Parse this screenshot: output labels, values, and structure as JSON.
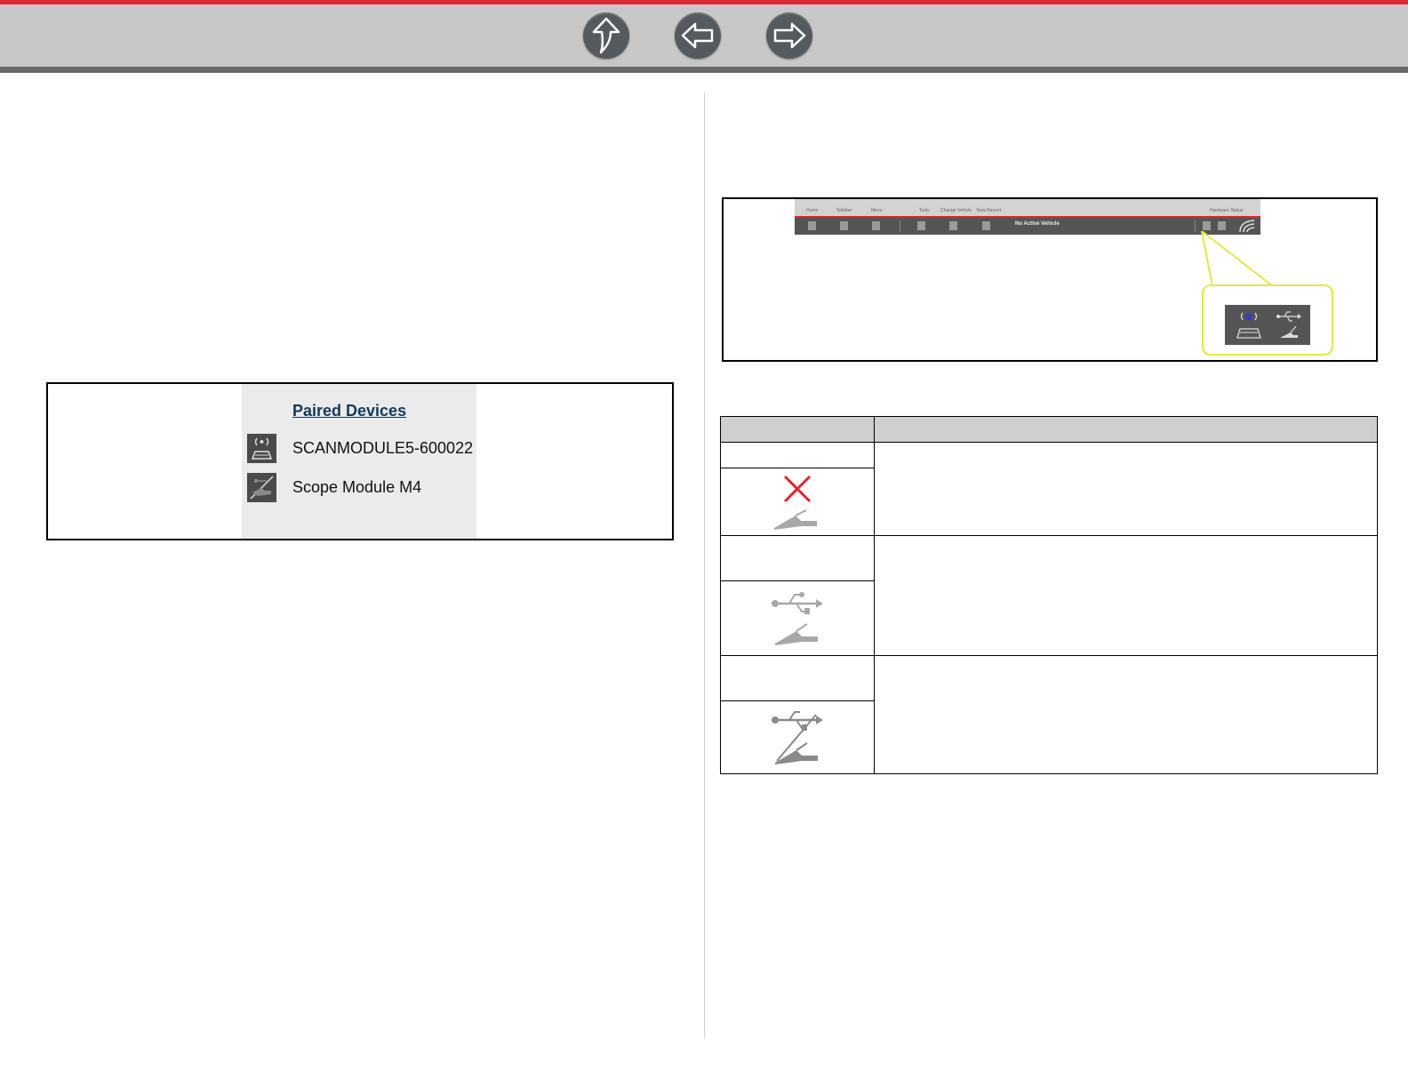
{
  "nav": {
    "up_icon": "up-arrow-icon",
    "back_icon": "left-arrow-icon",
    "forward_icon": "right-arrow-icon"
  },
  "paired_devices": {
    "title": "Paired Devices",
    "items": [
      {
        "label": "SCANMODULE5-600022",
        "icon": "scan-module-icon"
      },
      {
        "label": "Scope Module M4",
        "icon": "scope-module-icon"
      }
    ]
  },
  "toolbar": {
    "tabs": [
      "Home",
      "Sidebar",
      "Menu",
      "Tools",
      "Change Vehicle",
      "View Recent",
      "Hardware Status"
    ],
    "vehicle_status": "No Active Vehicle"
  },
  "status_table": {
    "icons": [
      "scope-not-connected-icon",
      "usb-scope-connected-icon",
      "usb-scope-disconnected-icon"
    ]
  },
  "colors": {
    "accent_red": "#e0262e",
    "nav_gray": "#c8c8c8",
    "callout_yellow": "#e6e64a"
  }
}
